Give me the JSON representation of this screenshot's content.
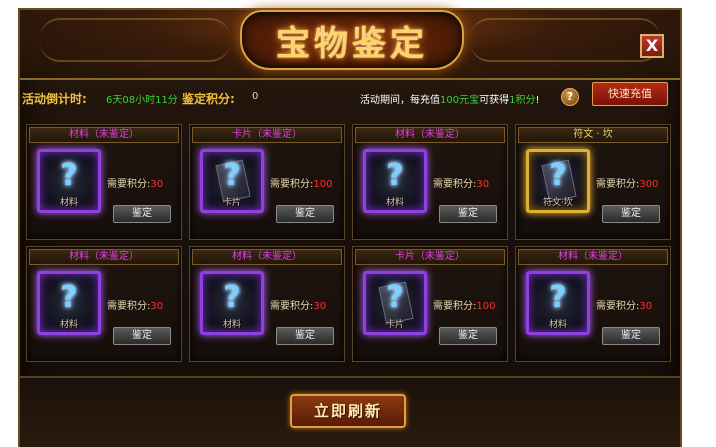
{
  "title": "宝物鉴定",
  "close_label": "X",
  "info": {
    "countdown_label": "活动倒计时:",
    "countdown_value": "6天08小时11分",
    "score_label": "鉴定积分:",
    "score_value": "0",
    "promo_prefix": "活动期间，每充值",
    "promo_amount": "100元宝",
    "promo_mid": "可获得",
    "promo_reward": "1积分",
    "promo_suffix": "!",
    "help_label": "?",
    "recharge_label": "快速充值"
  },
  "cards": [
    {
      "header": "材料（未鉴定）",
      "slot_label": "材料",
      "type": "material",
      "rarity": "purple",
      "need_label": "需要积分:",
      "need_value": "30",
      "button": "鉴定"
    },
    {
      "header": "卡片（未鉴定）",
      "slot_label": "卡片",
      "type": "card",
      "rarity": "purple",
      "need_label": "需要积分:",
      "need_value": "100",
      "button": "鉴定"
    },
    {
      "header": "材料（未鉴定）",
      "slot_label": "材料",
      "type": "material",
      "rarity": "purple",
      "need_label": "需要积分:",
      "need_value": "30",
      "button": "鉴定"
    },
    {
      "header": "符文 · 坎",
      "slot_label": "符文·坎",
      "type": "rune",
      "rarity": "gold",
      "need_label": "需要积分:",
      "need_value": "300",
      "button": "鉴定"
    },
    {
      "header": "材料（未鉴定）",
      "slot_label": "材料",
      "type": "material",
      "rarity": "purple",
      "need_label": "需要积分:",
      "need_value": "30",
      "button": "鉴定"
    },
    {
      "header": "材料（未鉴定）",
      "slot_label": "材料",
      "type": "material",
      "rarity": "purple",
      "need_label": "需要积分:",
      "need_value": "30",
      "button": "鉴定"
    },
    {
      "header": "卡片（未鉴定）",
      "slot_label": "卡片",
      "type": "card",
      "rarity": "purple",
      "need_label": "需要积分:",
      "need_value": "100",
      "button": "鉴定"
    },
    {
      "header": "材料（未鉴定）",
      "slot_label": "材料",
      "type": "material",
      "rarity": "purple",
      "need_label": "需要积分:",
      "need_value": "30",
      "button": "鉴定"
    }
  ],
  "refresh_label": "立即刷新",
  "colors": {
    "accent_gold": "#f0c040",
    "highlight_green": "#3bd13b",
    "cost_red": "#ff3030",
    "rarity_purple": "#9040e0",
    "rarity_gold": "#e0b030"
  },
  "icons": {
    "close": "close-icon",
    "help": "question-icon",
    "slot": "question-mark-icon"
  }
}
